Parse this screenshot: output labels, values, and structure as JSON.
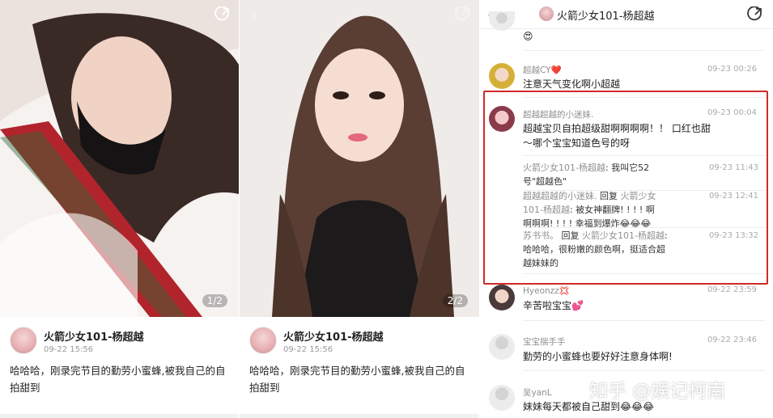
{
  "post": {
    "author": "火箭少女101-杨超越",
    "date": "09-22 15:56",
    "text": "哈哈哈，刚录完节目的勤劳小蜜蜂,被我自己的自拍甜到"
  },
  "photos": [
    {
      "counter": "1/2"
    },
    {
      "counter": "2/2"
    }
  ],
  "comments_header": {
    "title": "火箭少女101-杨超越"
  },
  "comments": [
    {
      "text": "😍"
    },
    {
      "name": "超越CY❤️",
      "time": "09-23 00:26",
      "text": "注意天气变化啊小超越"
    },
    {
      "name": "超越超越的小迷妹.",
      "time": "09-23 00:04",
      "text_line1": "超越宝贝自拍超级甜啊啊啊啊！！ 口红也甜",
      "text_line2": "～哪个宝宝知道色号的呀"
    },
    {
      "name": "Hyeonzz💢",
      "time": "09-22 23:59",
      "text": "辛苦啦宝宝💕"
    },
    {
      "name": "宝宝揣手手",
      "time": "09-22 23:46",
      "text": "勤劳的小蜜蜂也要好好注意身体啊!"
    },
    {
      "name": "吴yanL",
      "time": "",
      "text": "妹妹每天都被自己甜到😂😂😂"
    }
  ],
  "replies": [
    {
      "name": "火箭少女101-杨超越",
      "sep": ": ",
      "text_line1": "我叫它52",
      "text_line2": "号\"超越色\"",
      "time": "09-23 11:43"
    },
    {
      "name": "超越超越的小迷妹.",
      "word_reply": "回复",
      "target_line1": "火箭少女",
      "target_line2": "101-杨超越",
      "text_line2": ": 被女神翻牌! ! ! ! 啊",
      "text_line3": "啊啊啊! ! ! ! 幸福到爆炸😂😂😂",
      "time": "09-23 12:41"
    },
    {
      "name": "苏书书。",
      "word_reply": "回复",
      "target": "火箭少女101-杨超越",
      "text_line1": ":",
      "text_line2": "哈哈哈，很粉嫩的颜色啊，挺适合超",
      "text_line3": "越妹妹的",
      "time": "09-23 13:32"
    }
  ],
  "watermark": "知乎 @娱记柯南"
}
